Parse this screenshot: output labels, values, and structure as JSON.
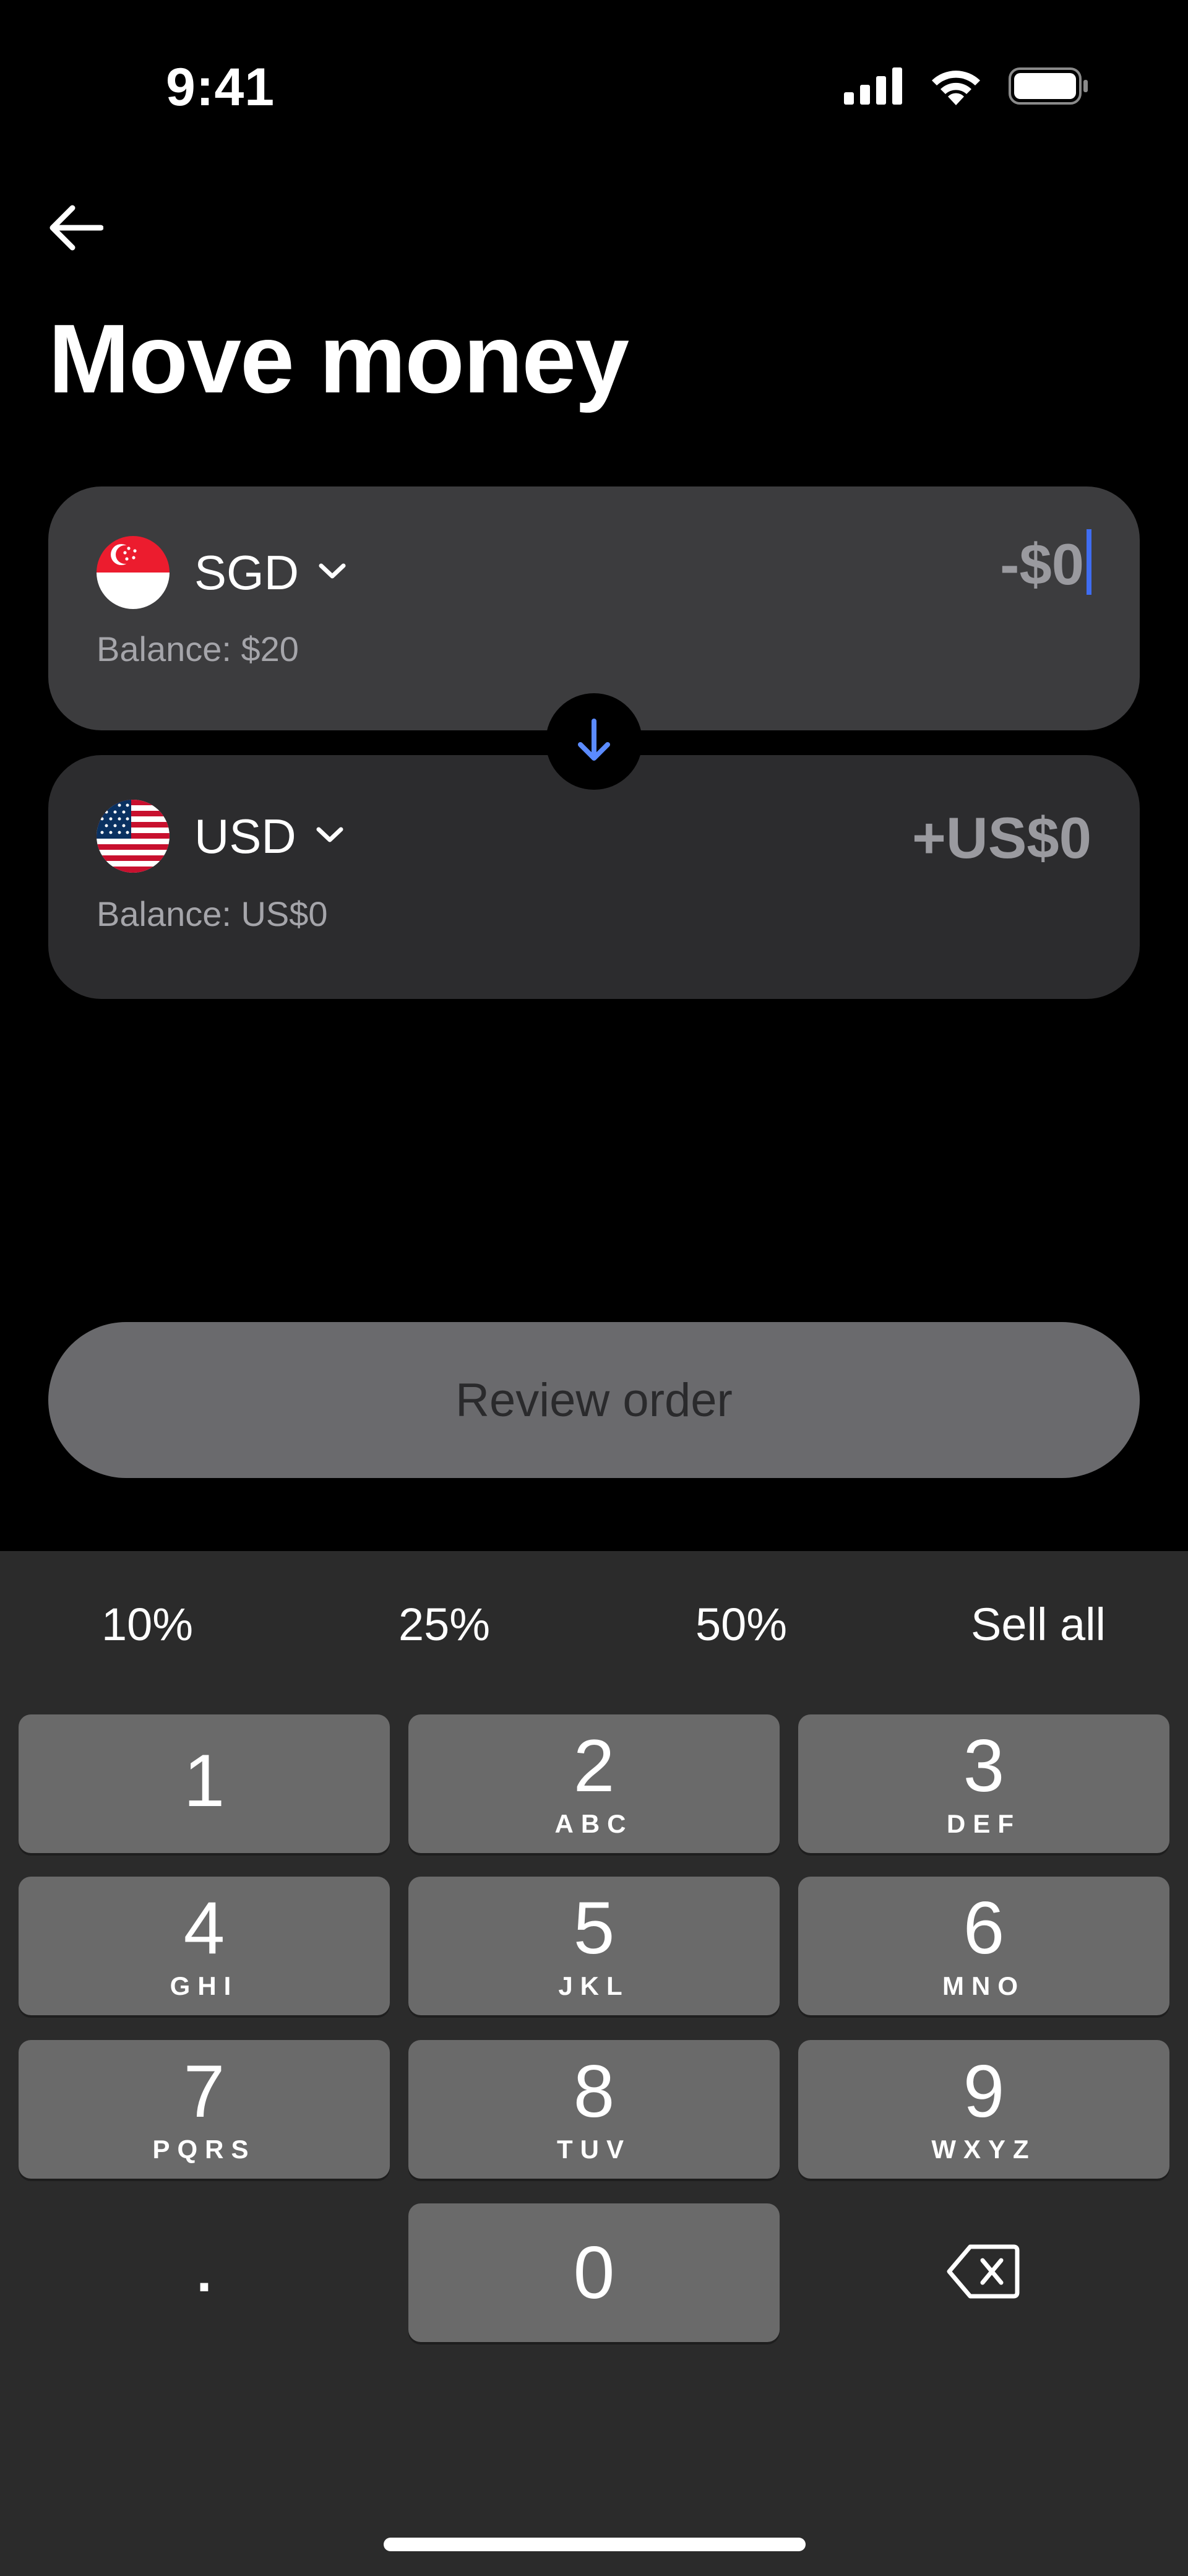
{
  "status_bar": {
    "time": "9:41"
  },
  "header": {
    "title": "Move money"
  },
  "from_card": {
    "currency": "SGD",
    "balance": "Balance: $20",
    "amount": "-$0"
  },
  "to_card": {
    "currency": "USD",
    "balance": "Balance: US$0",
    "amount": "+US$0"
  },
  "review_button": {
    "label": "Review order"
  },
  "shortcuts": [
    "10%",
    "25%",
    "50%",
    "Sell all"
  ],
  "keypad": {
    "k1": {
      "num": "1",
      "letters": ""
    },
    "k2": {
      "num": "2",
      "letters": "ABC"
    },
    "k3": {
      "num": "3",
      "letters": "DEF"
    },
    "k4": {
      "num": "4",
      "letters": "GHI"
    },
    "k5": {
      "num": "5",
      "letters": "JKL"
    },
    "k6": {
      "num": "6",
      "letters": "MNO"
    },
    "k7": {
      "num": "7",
      "letters": "PQRS"
    },
    "k8": {
      "num": "8",
      "letters": "TUV"
    },
    "k9": {
      "num": "9",
      "letters": "WXYZ"
    },
    "k0": {
      "num": "0",
      "letters": ""
    },
    "decimal": "."
  },
  "colors": {
    "background": "#000000",
    "card_active": "#3c3c3e",
    "card_inactive": "#2c2c2e",
    "accent": "#3f6df2",
    "keyboard": "#2b2b2b",
    "key": "#6a6a6a"
  },
  "icons": [
    "signal-icon",
    "wifi-icon",
    "battery-icon",
    "back-arrow-icon",
    "chevron-down-icon",
    "arrow-down-icon",
    "backspace-icon",
    "singapore-flag-icon",
    "us-flag-icon"
  ]
}
